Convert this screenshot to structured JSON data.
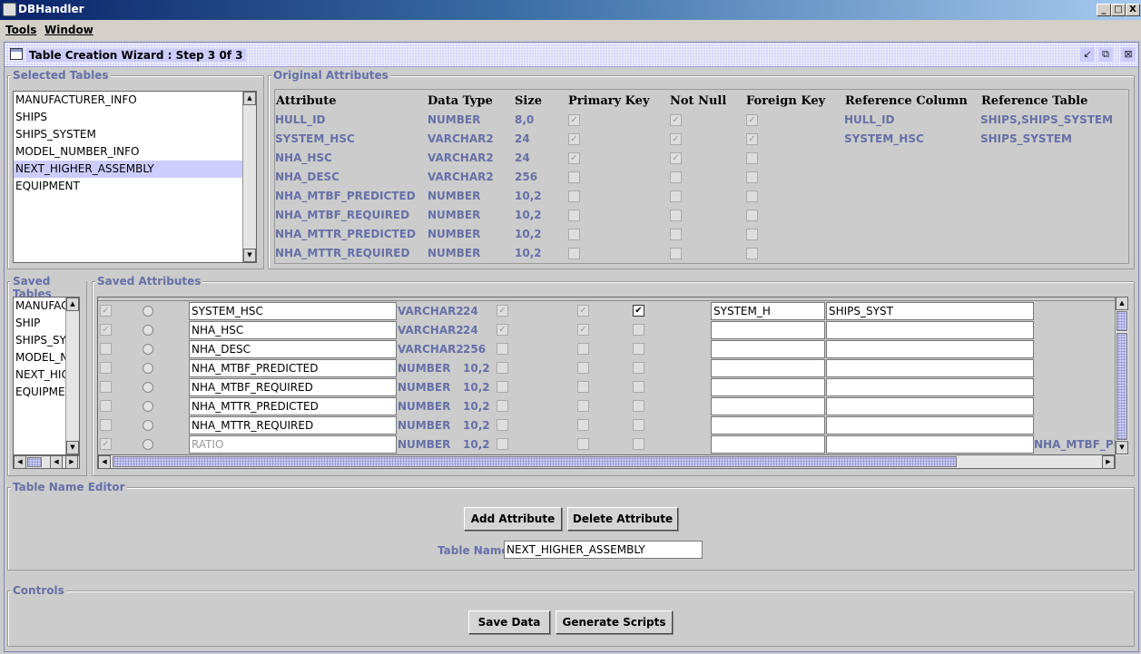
{
  "window": {
    "title": "DBHandler",
    "minimize": "_",
    "maximize": "□",
    "close": "X"
  },
  "menu": [
    "Tools",
    "Window"
  ],
  "wizard": {
    "title": "Table Creation Wizard : Step 3 0f 3"
  },
  "selected_tables": {
    "label": "Selected Tables",
    "items": [
      "MANUFACTURER_INFO",
      "SHIPS",
      "SHIPS_SYSTEM",
      "MODEL_NUMBER_INFO",
      "NEXT_HIGHER_ASSEMBLY",
      "EQUIPMENT"
    ],
    "selected_index": 4
  },
  "original_attributes": {
    "label": "Original Attributes",
    "headers": [
      "Attribute",
      "Data Type",
      "Size",
      "Primary Key",
      "Not Null",
      "Foreign Key",
      "Reference Column",
      "Reference Table"
    ],
    "rows": [
      {
        "attr": "HULL_ID",
        "type": "NUMBER",
        "size": "8,0",
        "pk": true,
        "nn": true,
        "fk": true,
        "ref_col": "HULL_ID",
        "ref_table": "SHIPS,SHIPS_SYSTEM"
      },
      {
        "attr": "SYSTEM_HSC",
        "type": "VARCHAR2",
        "size": "24",
        "pk": true,
        "nn": true,
        "fk": true,
        "ref_col": "SYSTEM_HSC",
        "ref_table": "SHIPS_SYSTEM"
      },
      {
        "attr": "NHA_HSC",
        "type": "VARCHAR2",
        "size": "24",
        "pk": true,
        "nn": true,
        "fk": false,
        "ref_col": "",
        "ref_table": ""
      },
      {
        "attr": "NHA_DESC",
        "type": "VARCHAR2",
        "size": "256",
        "pk": false,
        "nn": false,
        "fk": false,
        "ref_col": "",
        "ref_table": ""
      },
      {
        "attr": "NHA_MTBF_PREDICTED",
        "type": "NUMBER",
        "size": "10,2",
        "pk": false,
        "nn": false,
        "fk": false,
        "ref_col": "",
        "ref_table": ""
      },
      {
        "attr": "NHA_MTBF_REQUIRED",
        "type": "NUMBER",
        "size": "10,2",
        "pk": false,
        "nn": false,
        "fk": false,
        "ref_col": "",
        "ref_table": ""
      },
      {
        "attr": "NHA_MTTR_PREDICTED",
        "type": "NUMBER",
        "size": "10,2",
        "pk": false,
        "nn": false,
        "fk": false,
        "ref_col": "",
        "ref_table": ""
      },
      {
        "attr": "NHA_MTTR_REQUIRED",
        "type": "NUMBER",
        "size": "10,2",
        "pk": false,
        "nn": false,
        "fk": false,
        "ref_col": "",
        "ref_table": ""
      }
    ]
  },
  "saved_tables": {
    "label": "Saved Tables",
    "items": [
      "MANUFAC",
      "SHIP",
      "SHIPS_SY",
      "MODEL_N",
      "NEXT_HIG",
      "EQUIPME"
    ]
  },
  "saved_attributes": {
    "label": "Saved Attributes",
    "rows": [
      {
        "c1": true,
        "name": "SYSTEM_HSC",
        "type": "VARCHAR2",
        "size": "24",
        "c2": true,
        "c3": true,
        "c4": true,
        "ref1": "SYSTEM_H",
        "ref2": "SHIPS_SYST",
        "ref3": "",
        "disabled": false
      },
      {
        "c1": true,
        "name": "NHA_HSC",
        "type": "VARCHAR2",
        "size": "24",
        "c2": true,
        "c3": true,
        "c4": false,
        "ref1": "",
        "ref2": "",
        "ref3": "",
        "disabled": false
      },
      {
        "c1": false,
        "name": "NHA_DESC",
        "type": "VARCHAR2",
        "size": "256",
        "c2": false,
        "c3": false,
        "c4": false,
        "ref1": "",
        "ref2": "",
        "ref3": "",
        "disabled": false
      },
      {
        "c1": false,
        "name": "NHA_MTBF_PREDICTED",
        "type": "NUMBER",
        "size": "10,2",
        "c2": false,
        "c3": false,
        "c4": false,
        "ref1": "",
        "ref2": "",
        "ref3": "",
        "disabled": false
      },
      {
        "c1": false,
        "name": "NHA_MTBF_REQUIRED",
        "type": "NUMBER",
        "size": "10,2",
        "c2": false,
        "c3": false,
        "c4": false,
        "ref1": "",
        "ref2": "",
        "ref3": "",
        "disabled": false
      },
      {
        "c1": false,
        "name": "NHA_MTTR_PREDICTED",
        "type": "NUMBER",
        "size": "10,2",
        "c2": false,
        "c3": false,
        "c4": false,
        "ref1": "",
        "ref2": "",
        "ref3": "",
        "disabled": false
      },
      {
        "c1": false,
        "name": "NHA_MTTR_REQUIRED",
        "type": "NUMBER",
        "size": "10,2",
        "c2": false,
        "c3": false,
        "c4": false,
        "ref1": "",
        "ref2": "",
        "ref3": "",
        "disabled": false
      },
      {
        "c1": true,
        "name": "RATIO",
        "type": "NUMBER",
        "size": "10,2",
        "c2": false,
        "c3": false,
        "c4": false,
        "ref1": "",
        "ref2": "",
        "ref3": "NHA_MTBF_PRE",
        "disabled": true
      }
    ]
  },
  "table_name_editor": {
    "label": "Table Name Editor",
    "add_button": "Add Attribute",
    "delete_button": "Delete Attribute",
    "table_name_label": "Table Name",
    "table_name_value": "NEXT_HIGHER_ASSEMBLY"
  },
  "controls": {
    "label": "Controls",
    "save_button": "Save Data",
    "generate_button": "Generate Scripts"
  },
  "colors": {
    "accent": "#6670a8",
    "selection": "#ccccff",
    "titlebar": "#0a246a"
  }
}
